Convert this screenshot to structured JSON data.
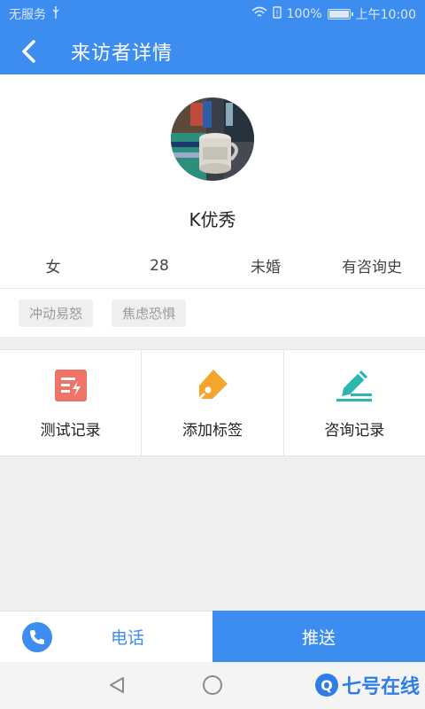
{
  "status_bar": {
    "carrier": "无服务",
    "battery": "100%",
    "time": "上午10:00"
  },
  "header": {
    "title": "来访者详情"
  },
  "profile": {
    "name": "K优秀"
  },
  "info": [
    "女",
    "28",
    "未婚",
    "有咨询史"
  ],
  "tags": [
    "冲动易怒",
    "焦虑恐惧"
  ],
  "actions": [
    {
      "label": "测试记录",
      "icon": "test-record-icon"
    },
    {
      "label": "添加标签",
      "icon": "add-tag-icon"
    },
    {
      "label": "咨询记录",
      "icon": "consult-record-icon"
    }
  ],
  "bottom": {
    "phone_label": "电话",
    "push_label": "推送"
  },
  "watermark": "七号在线",
  "colors": {
    "primary": "#3d8cf0",
    "test_icon": "#ef7468",
    "tag_icon": "#f4a52c",
    "consult_icon": "#2bb6b0"
  }
}
